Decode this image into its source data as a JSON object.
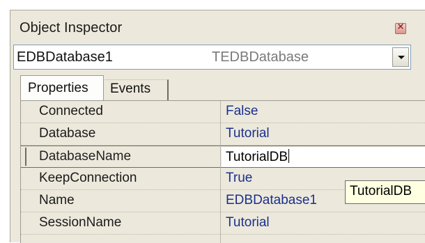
{
  "window": {
    "title": "Object Inspector",
    "close_icon": "close-icon"
  },
  "component_selector": {
    "name": "EDBDatabase1",
    "class_name": "TEDBDatabase"
  },
  "tabs": [
    {
      "label": "Properties",
      "active": true
    },
    {
      "label": "Events",
      "active": false
    }
  ],
  "properties": [
    {
      "name": "Connected",
      "value": "False"
    },
    {
      "name": "Database",
      "value": "Tutorial"
    },
    {
      "name": "DatabaseName",
      "value": "TutorialDB",
      "editing": true
    },
    {
      "name": "KeepConnection",
      "value": "True"
    },
    {
      "name": "Name",
      "value": "EDBDatabase1"
    },
    {
      "name": "SessionName",
      "value": "Tutorial"
    }
  ],
  "tooltip": {
    "text": "TutorialDB"
  },
  "colors": {
    "value_text": "#1b2f8c",
    "panel_bg": "#ece9dc",
    "tooltip_bg": "#ffffe1"
  }
}
